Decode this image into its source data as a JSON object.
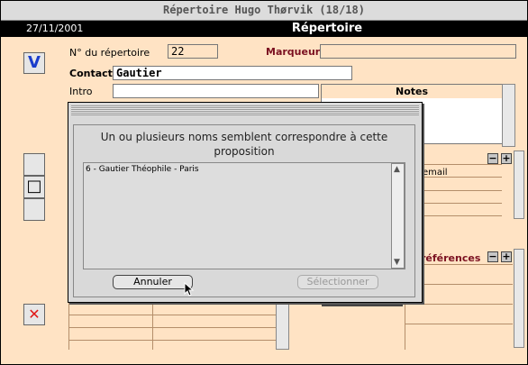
{
  "window": {
    "title": "Répertoire Hugo Thørvik (18/18)"
  },
  "header": {
    "date": "27/11/2001",
    "title": "Répertoire"
  },
  "form": {
    "num_label": "N° du répertoire",
    "num_value": "22",
    "marker_label": "Marqueur",
    "marker_value": "",
    "contact_label": "Contact",
    "contact_value": "Gautier",
    "intro_label": "Intro",
    "intro_value": "",
    "notes_label": "Notes",
    "email_label": "email",
    "references_label": "références"
  },
  "sidebar": {
    "validate_icon": "V",
    "stop_icon": "□",
    "delete_icon": "✕"
  },
  "dialog": {
    "message": "Un ou plusieurs noms semblent correspondre à cette proposition",
    "items": [
      "6 - Gautier Théophile - Paris"
    ],
    "cancel_label": "Annuler",
    "select_label": "Sélectionner"
  },
  "icons": {
    "minus": "−",
    "plus": "+"
  },
  "colors": {
    "form_background": "#ffe3c4",
    "accent_maroon": "#7b1020",
    "header_background": "#000000"
  }
}
